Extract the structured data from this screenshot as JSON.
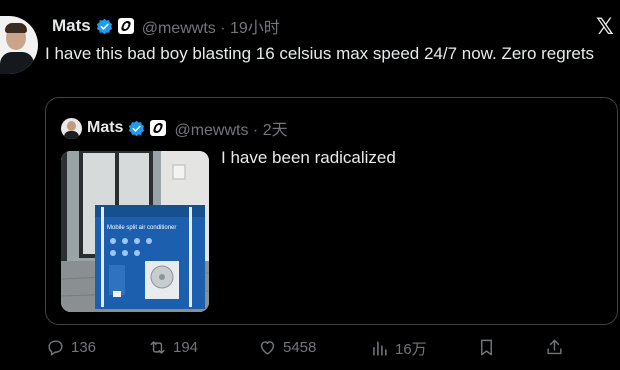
{
  "tweet": {
    "author_name": "Mats",
    "handle": "@mewwts",
    "time": "19小时",
    "text": "I have this bad boy blasting 16 celsius max speed 24/7 now. Zero regrets"
  },
  "quote": {
    "author_name": "Mats",
    "handle": "@mewwts",
    "time": "2天",
    "text": "I have been radicalized",
    "box_title": "Mobile split air conditioner"
  },
  "actions": {
    "replies": "136",
    "reposts": "194",
    "likes": "5458",
    "views": "16万"
  },
  "colors": {
    "background": "#000000",
    "text": "#e7e9ea",
    "muted": "#71767b",
    "verified": "#1d9bf0",
    "border": "#3e4144"
  }
}
